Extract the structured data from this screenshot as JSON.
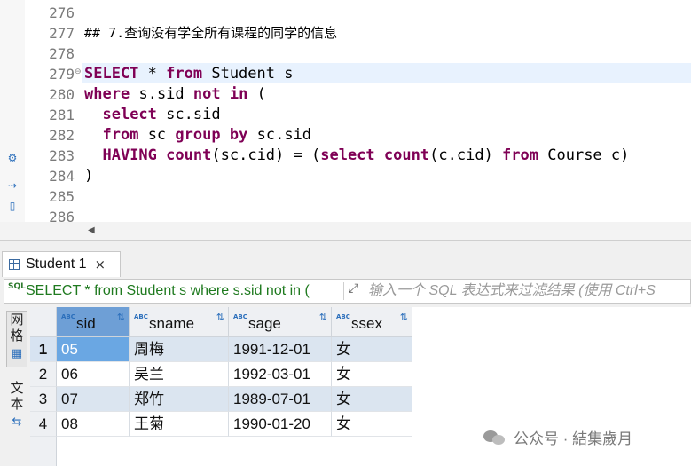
{
  "editor": {
    "lines": [
      {
        "num": "276",
        "text": ""
      },
      {
        "num": "277",
        "text": "## 7.查询没有学全所有课程的同学的信息"
      },
      {
        "num": "278",
        "text": ""
      },
      {
        "num": "279",
        "text": "SELECT * from Student s"
      },
      {
        "num": "280",
        "text": "where s.sid not in ("
      },
      {
        "num": "281",
        "text": "  select sc.sid"
      },
      {
        "num": "282",
        "text": "  from sc group by sc.sid"
      },
      {
        "num": "283",
        "text": "  HAVING count(sc.cid) = (select count(c.cid) from Course c)"
      },
      {
        "num": "284",
        "text": ")"
      },
      {
        "num": "285",
        "text": ""
      },
      {
        "num": "286",
        "text": ""
      }
    ],
    "fold_marker": "⊖",
    "scroll_left_arrow": "◀",
    "sidebar_icons": [
      "gear-icon",
      "script-icon",
      "file-icon",
      "export-icon"
    ]
  },
  "results": {
    "tab_label": "Student 1",
    "tab_close": "×",
    "filter": {
      "sql_icon_label": "SQL",
      "sql_text": "SELECT * from Student s where s.sid not in (",
      "expand_icon": "⤢",
      "placeholder": "输入一个 SQL 表达式来过滤结果 (使用 Ctrl+S"
    },
    "side_tabs": {
      "grid_label": "网格",
      "text_label": "文本"
    },
    "columns": [
      "sid",
      "sname",
      "sage",
      "ssex"
    ],
    "type_badge": "ABC",
    "rows": [
      {
        "num": "1",
        "cells": [
          "05",
          "周梅",
          "1991-12-01",
          "女"
        ]
      },
      {
        "num": "2",
        "cells": [
          "06",
          "吴兰",
          "1992-03-01",
          "女"
        ]
      },
      {
        "num": "3",
        "cells": [
          "07",
          "郑竹",
          "1989-07-01",
          "女"
        ]
      },
      {
        "num": "4",
        "cells": [
          "08",
          "王菊",
          "1990-01-20",
          "女"
        ]
      }
    ]
  },
  "watermark": "公众号 · 結集歲月",
  "colors": {
    "keyword": "#7f0055",
    "selected_cell": "#6aa7e3",
    "alt_row": "#dbe5f0",
    "filter_text": "#1f7a1f",
    "current_line": "#e8f2fe"
  }
}
